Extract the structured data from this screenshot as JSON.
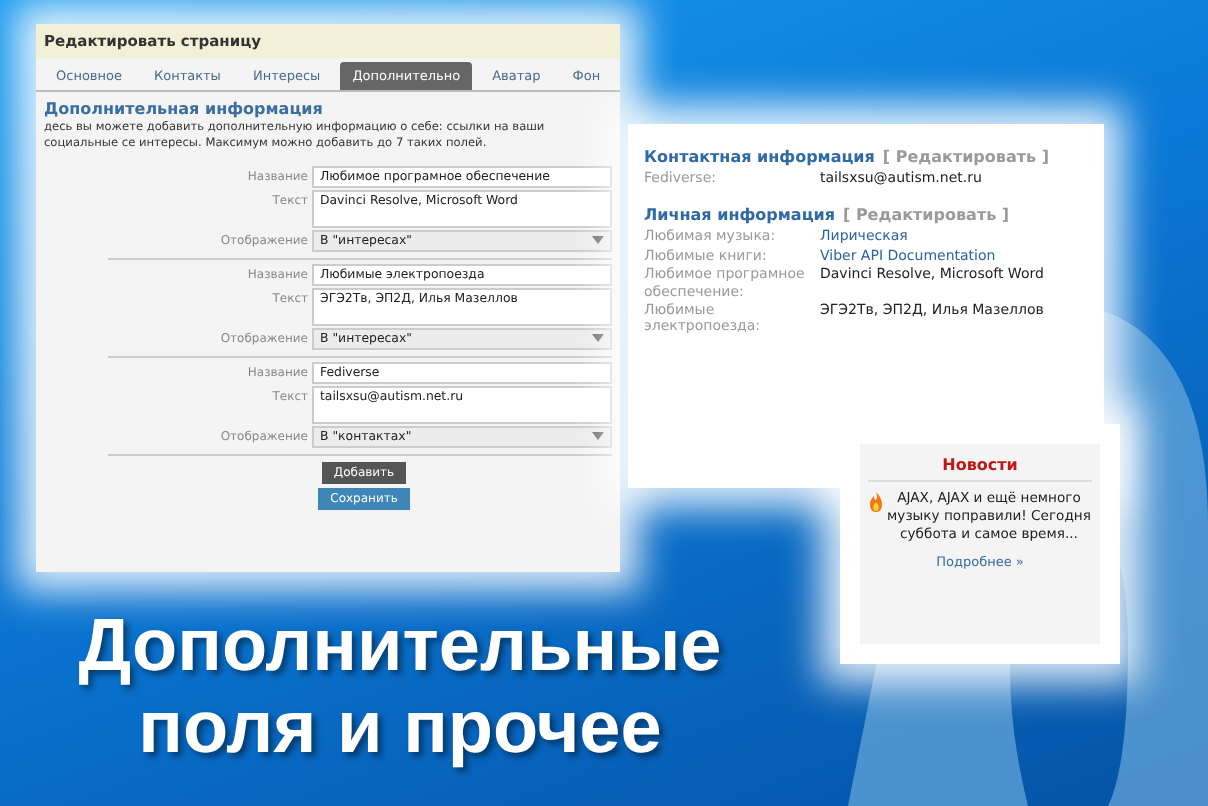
{
  "edit_window": {
    "title": "Редактировать страницу",
    "tabs": [
      {
        "label": "Основное",
        "selected": false
      },
      {
        "label": "Контакты",
        "selected": false
      },
      {
        "label": "Интересы",
        "selected": false
      },
      {
        "label": "Дополнительно",
        "selected": true
      },
      {
        "label": "Аватар",
        "selected": false
      },
      {
        "label": "Фон",
        "selected": false
      }
    ],
    "section_title": "Дополнительная информация",
    "description": "десь вы можете добавить дополнительную информацию о себе: ссылки на ваши социальные се интересы. Максимум можно добавить до 7 таких полей.",
    "groups": [
      {
        "name_label": "Название",
        "name": "Любимое програмное обеспечение",
        "text_label": "Текст",
        "text": "Davinci Resolve, Microsoft Word",
        "display_label": "Отображение",
        "display": "В \"интересах\""
      },
      {
        "name_label": "Название",
        "name": "Любимые электропоезда",
        "text_label": "Текст",
        "text": "ЭГЭ2Тв, ЭП2Д, Илья Мазеллов",
        "display_label": "Отображение",
        "display": "В \"интересах\""
      },
      {
        "name_label": "Название",
        "name": "Fediverse",
        "text_label": "Текст",
        "text": "tailsxsu@autism.net.ru",
        "display_label": "Отображение",
        "display": "В \"контактах\""
      }
    ],
    "buttons": [
      {
        "label": "Добавить",
        "kind": "secondary"
      },
      {
        "label": "Сохранить",
        "kind": "primary"
      }
    ]
  },
  "profile_window": {
    "sections": [
      {
        "title": "Контактная информация",
        "edit_link": "[ Редактировать ]",
        "rows": [
          {
            "label": "Fediverse:",
            "value": "tailsxsu@autism.net.ru",
            "kind": "plain"
          }
        ]
      },
      {
        "title": "Личная информация",
        "edit_link": "[ Редактировать ]",
        "rows": [
          {
            "label": "Любимая музыка:",
            "value": "Лирическая",
            "kind": "link"
          },
          {
            "label": "Любимые книги:",
            "value": "Viber API Documentation",
            "kind": "link"
          },
          {
            "label": "Любимое програмное обеспечение:",
            "value": "Davinci Resolve, Microsoft Word",
            "kind": "plain"
          },
          {
            "label": "Любимые электропоезда:",
            "value": "ЭГЭ2Тв, ЭП2Д, Илья Мазеллов",
            "kind": "plain"
          }
        ]
      }
    ]
  },
  "news_window": {
    "title": "Новости",
    "text": "AJAX, AJAX и ещё немного музыку поправили! Сегодня суббота и самое время...",
    "more_link": "Подробнее »"
  },
  "headline": [
    "Дополнительные",
    "поля и прочее"
  ]
}
